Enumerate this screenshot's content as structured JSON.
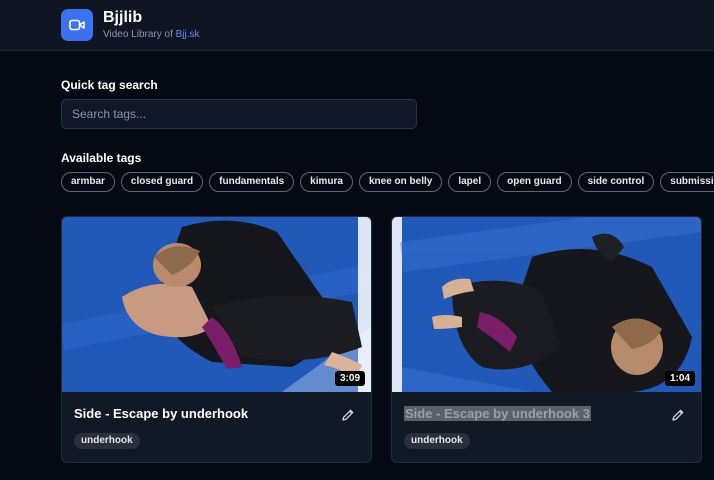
{
  "header": {
    "title": "Bjjlib",
    "subtitle_prefix": "Video Library of ",
    "subtitle_link": "Bjj.sk"
  },
  "search": {
    "label": "Quick tag search",
    "placeholder": "Search tags..."
  },
  "tags_section": {
    "label": "Available tags",
    "items": [
      "armbar",
      "closed guard",
      "fundamentals",
      "kimura",
      "knee on belly",
      "lapel",
      "open guard",
      "side control",
      "submissions"
    ]
  },
  "videos": [
    {
      "title": "Side - Escape by underhook",
      "duration": "3:09",
      "tags": [
        "underhook"
      ]
    },
    {
      "title": "Side - Escape by underhook 3",
      "duration": "1:04",
      "tags": [
        "underhook"
      ]
    }
  ],
  "colors": {
    "accent": "#3b72f0",
    "link": "#5b8ef5",
    "background": "#050913",
    "card": "#121926",
    "mat_blue": "#2159b9"
  }
}
